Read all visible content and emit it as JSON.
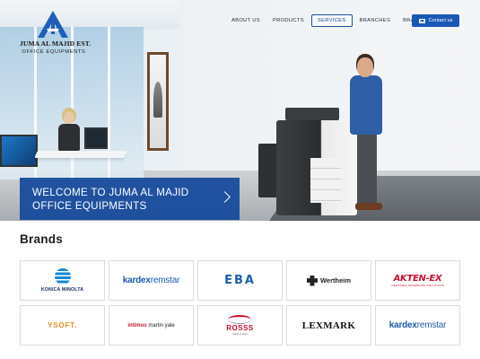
{
  "header": {
    "logo": {
      "name": "JUMA AL MAJID EST.",
      "sub": "OFFICE EQUIPMENTS",
      "icon": "jam-logo-icon"
    },
    "nav": [
      {
        "label": "ABOUT US",
        "active": false
      },
      {
        "label": "PRODUCTS",
        "active": false
      },
      {
        "label": "SERVICES",
        "active": true
      },
      {
        "label": "BRANCHES",
        "active": false
      },
      {
        "label": "BRANDS",
        "active": false
      }
    ],
    "contact": {
      "label": "Contact us",
      "icon": "mail-icon"
    }
  },
  "hero": {
    "banner_line1": "WELCOME TO JUMA AL MAJID",
    "banner_line2": "OFFICE EQUIPMENTS",
    "arrow_icon": "chevron-right-icon"
  },
  "brands": {
    "title": "Brands",
    "items": [
      {
        "name": "KONICA MINOLTA"
      },
      {
        "name": "kardex",
        "suffix": "remstar"
      },
      {
        "name": "EBA"
      },
      {
        "name": "Wertheim"
      },
      {
        "name": "AKTEN-EX",
        "sub": "CERTIFIED SHREDDING SOLUTIONS"
      },
      {
        "name": "YSOFT."
      },
      {
        "name": "intimus",
        "suffix": "martin yale"
      },
      {
        "name": "ROSSS",
        "sub": "ready to store"
      },
      {
        "name": "LEXMARK"
      },
      {
        "name": "kardex",
        "suffix": "remstar"
      }
    ]
  },
  "colors": {
    "primary": "#1959b4",
    "banner": "#12489b",
    "accent_red": "#c8102e"
  }
}
